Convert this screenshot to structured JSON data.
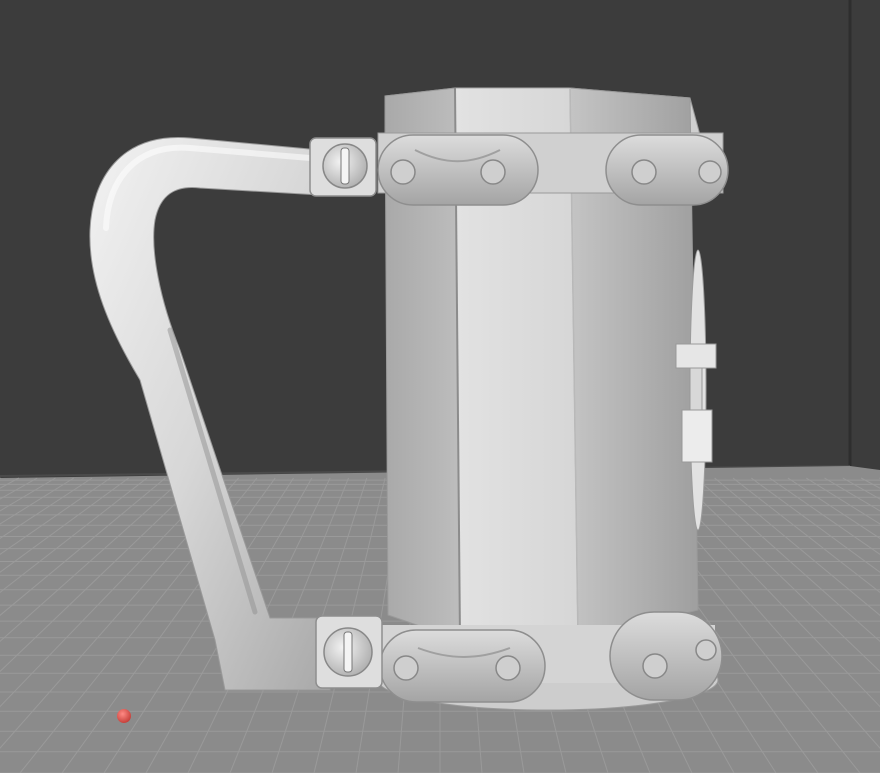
{
  "viewport": {
    "background_color": "#3a3a3a",
    "wall_color": "#3d3d3d",
    "floor_color": "#8a8a8a",
    "grid_color": "#9d9d9d",
    "model_color": "#d6d6d6",
    "origin_marker_color": "#e0554f"
  },
  "model": {
    "name": "",
    "parts": [
      "mug-body",
      "handle",
      "top-chain-band",
      "bottom-chain-band",
      "bolt-clamp-top",
      "bolt-clamp-bottom",
      "side-clip"
    ]
  }
}
